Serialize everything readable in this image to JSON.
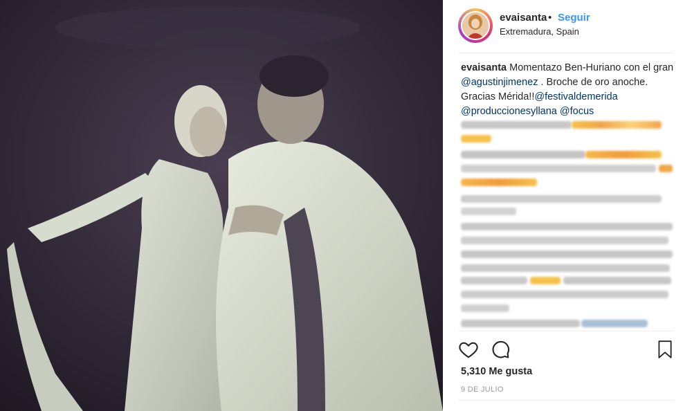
{
  "post": {
    "username": "evaisanta",
    "dot": "•",
    "follow_label": "Seguir",
    "location": "Extremadura, Spain",
    "caption": {
      "username": "evaisanta",
      "text1": " Momentazo Ben-Huriano con el gran ",
      "mention1": "@agustinjimenez",
      "text2": " . Broche de oro anoche. Gracias Mérida!!",
      "mention2": "@festivaldemerida",
      "text3": " ",
      "mention3": "@produccionesyllana",
      "text4": " ",
      "mention4": "@focus"
    },
    "likes": "5,310 Me gusta",
    "date": "9 DE JULIO"
  },
  "icons": {
    "like": "heart-icon",
    "comment": "comment-icon",
    "save": "bookmark-icon"
  },
  "colors": {
    "follow": "#3897f0",
    "mention": "#003569",
    "text": "#262626",
    "muted": "#999999"
  }
}
